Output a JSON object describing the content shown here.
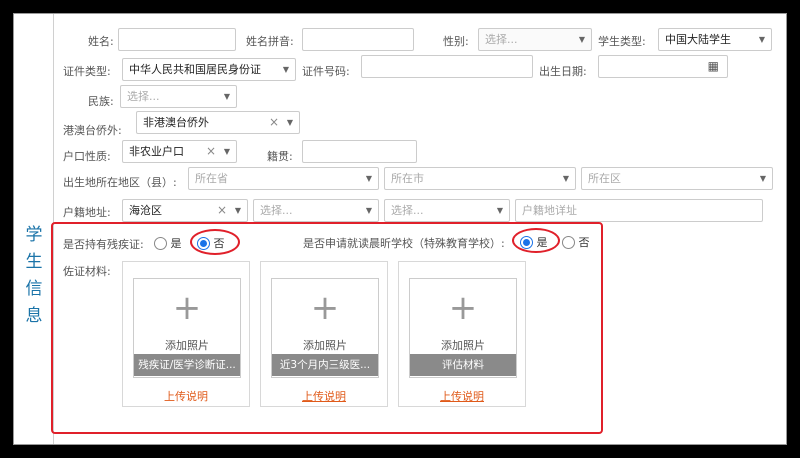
{
  "section_title": "学生信息",
  "row1": {
    "name_label": "姓名:",
    "pinyin_label": "姓名拼音:",
    "gender_label": "性别:",
    "gender_placeholder": "选择...",
    "type_label": "学生类型:",
    "type_value": "中国大陆学生"
  },
  "row2": {
    "idtype_label": "证件类型:",
    "idtype_value": "中华人民共和国居民身份证",
    "idno_label": "证件号码:",
    "birth_label": "出生日期:"
  },
  "row3": {
    "ethnic_label": "民族:",
    "ethnic_placeholder": "选择..."
  },
  "row4": {
    "overseas_label": "港澳台侨外:",
    "overseas_value": "非港澳台侨外"
  },
  "row5": {
    "hukou_label": "户口性质:",
    "hukou_value": "非农业户口",
    "jiguan_label": "籍贯:"
  },
  "row6": {
    "birthplace_label": "出生地所在地区（县）:",
    "province_placeholder": "所在省",
    "city_placeholder": "所在市",
    "district_placeholder": "所在区"
  },
  "row7": {
    "huji_label": "户籍地址:",
    "huji_value": "海沧区",
    "sel2_placeholder": "选择...",
    "sel3_placeholder": "选择...",
    "detail_placeholder": "户籍地详址"
  },
  "disability": {
    "label": "是否持有残疾证:",
    "yes": "是",
    "no": "否"
  },
  "special_school": {
    "label": "是否申请就读晨昕学校（特殊教育学校）:",
    "yes": "是",
    "no": "否"
  },
  "materials_label": "佐证材料:",
  "cards": [
    {
      "add": "添加照片",
      "band": "残疾证/医学诊断证...",
      "link": "上传说明"
    },
    {
      "add": "添加照片",
      "band": "近3个月内三级医...",
      "link": "上传说明"
    },
    {
      "add": "添加照片",
      "band": "评估材料",
      "link": "上传说明"
    }
  ],
  "icons": {
    "plus": "plus-icon",
    "caret": "caret-down-icon",
    "clear": "clear-icon",
    "calendar": "calendar-icon"
  },
  "colors": {
    "highlight": "#e0202a",
    "accent": "#1a73e8",
    "link": "#e05a1a"
  }
}
